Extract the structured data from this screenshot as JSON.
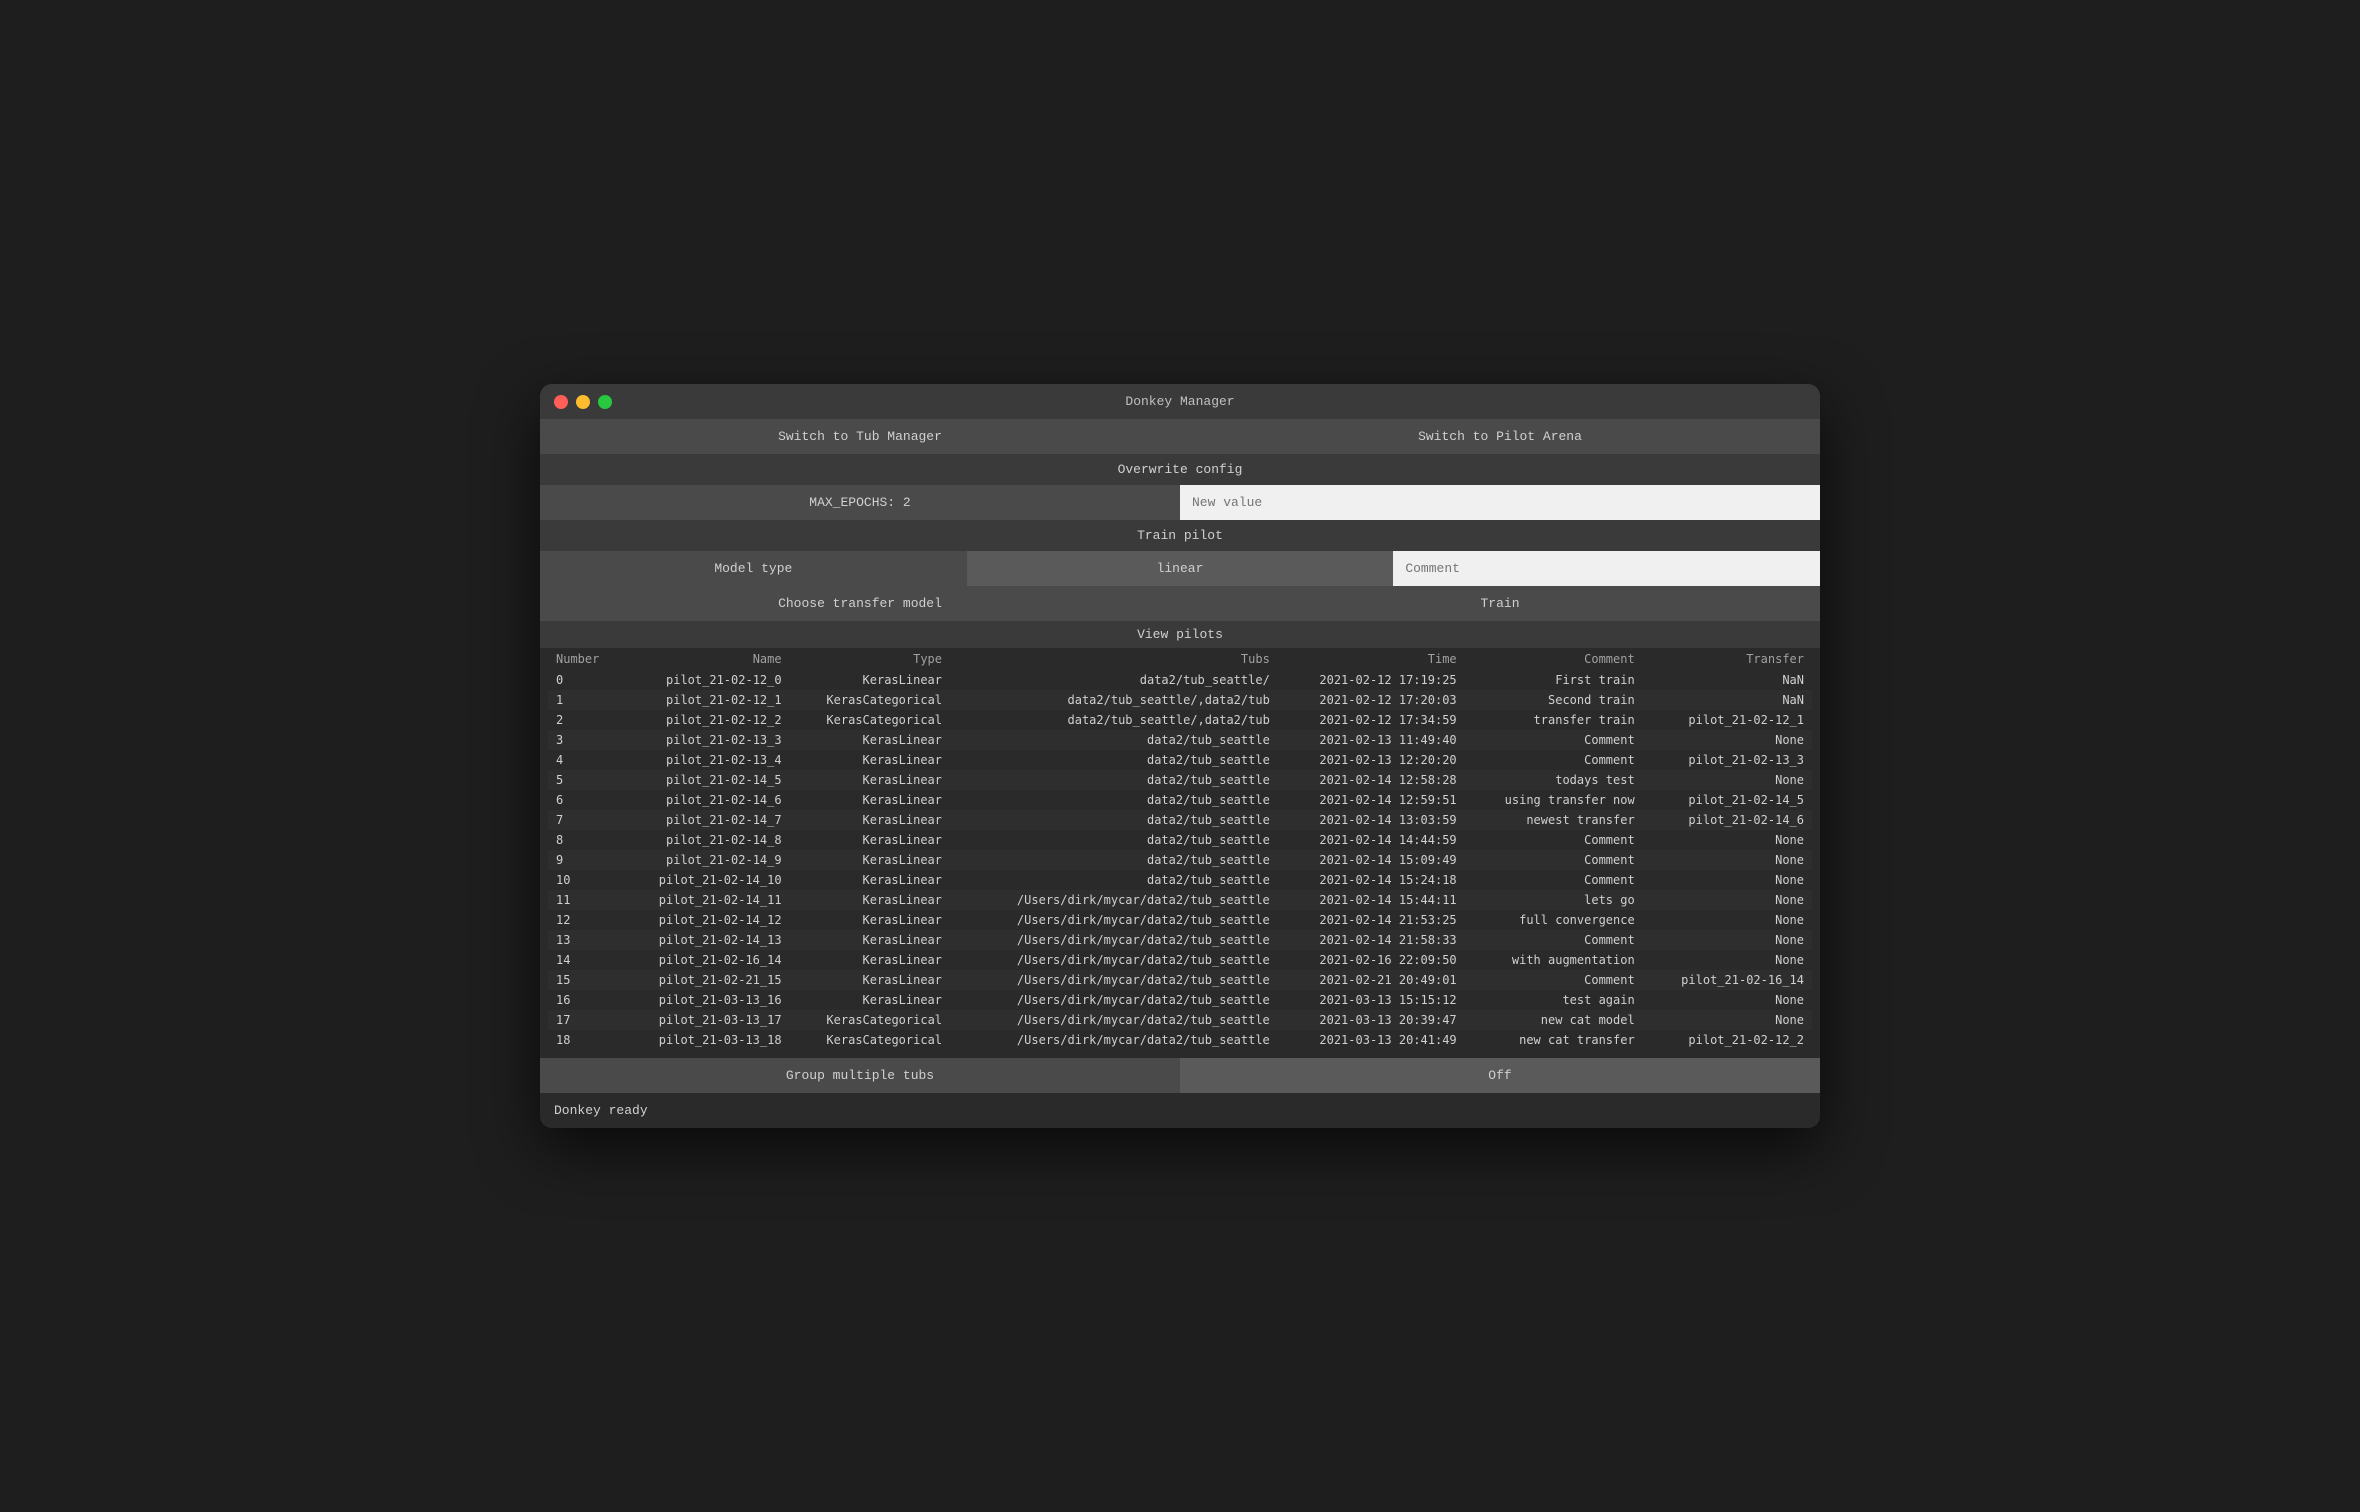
{
  "window": {
    "title": "Donkey Manager"
  },
  "toolbar": {
    "switch_tub_label": "Switch to Tub Manager",
    "switch_pilot_label": "Switch to Pilot Arena"
  },
  "overwrite_config": {
    "header": "Overwrite config",
    "max_epochs_label": "MAX_EPOCHS: 2",
    "new_value_placeholder": "New value"
  },
  "train_pilot": {
    "header": "Train pilot",
    "model_type_label": "Model type",
    "model_type_value": "linear",
    "comment_placeholder": "Comment",
    "choose_transfer_label": "Choose transfer model",
    "train_label": "Train"
  },
  "view_pilots": {
    "header": "View pilots",
    "columns": [
      "Number",
      "Name",
      "Type",
      "Tubs",
      "Time",
      "Comment",
      "Transfer"
    ],
    "rows": [
      {
        "number": "0",
        "name": "pilot_21-02-12_0",
        "type": "KerasLinear",
        "tubs": "data2/tub_seattle/",
        "time": "2021-02-12 17:19:25",
        "comment": "First train",
        "transfer": "NaN"
      },
      {
        "number": "1",
        "name": "pilot_21-02-12_1",
        "type": "KerasCategorical",
        "tubs": "data2/tub_seattle/,data2/tub",
        "time": "2021-02-12 17:20:03",
        "comment": "Second train",
        "transfer": "NaN"
      },
      {
        "number": "2",
        "name": "pilot_21-02-12_2",
        "type": "KerasCategorical",
        "tubs": "data2/tub_seattle/,data2/tub",
        "time": "2021-02-12 17:34:59",
        "comment": "transfer train",
        "transfer": "pilot_21-02-12_1"
      },
      {
        "number": "3",
        "name": "pilot_21-02-13_3",
        "type": "KerasLinear",
        "tubs": "data2/tub_seattle",
        "time": "2021-02-13 11:49:40",
        "comment": "Comment",
        "transfer": "None"
      },
      {
        "number": "4",
        "name": "pilot_21-02-13_4",
        "type": "KerasLinear",
        "tubs": "data2/tub_seattle",
        "time": "2021-02-13 12:20:20",
        "comment": "Comment",
        "transfer": "pilot_21-02-13_3"
      },
      {
        "number": "5",
        "name": "pilot_21-02-14_5",
        "type": "KerasLinear",
        "tubs": "data2/tub_seattle",
        "time": "2021-02-14 12:58:28",
        "comment": "todays test",
        "transfer": "None"
      },
      {
        "number": "6",
        "name": "pilot_21-02-14_6",
        "type": "KerasLinear",
        "tubs": "data2/tub_seattle",
        "time": "2021-02-14 12:59:51",
        "comment": "using transfer now",
        "transfer": "pilot_21-02-14_5"
      },
      {
        "number": "7",
        "name": "pilot_21-02-14_7",
        "type": "KerasLinear",
        "tubs": "data2/tub_seattle",
        "time": "2021-02-14 13:03:59",
        "comment": "newest transfer",
        "transfer": "pilot_21-02-14_6"
      },
      {
        "number": "8",
        "name": "pilot_21-02-14_8",
        "type": "KerasLinear",
        "tubs": "data2/tub_seattle",
        "time": "2021-02-14 14:44:59",
        "comment": "Comment",
        "transfer": "None"
      },
      {
        "number": "9",
        "name": "pilot_21-02-14_9",
        "type": "KerasLinear",
        "tubs": "data2/tub_seattle",
        "time": "2021-02-14 15:09:49",
        "comment": "Comment",
        "transfer": "None"
      },
      {
        "number": "10",
        "name": "pilot_21-02-14_10",
        "type": "KerasLinear",
        "tubs": "data2/tub_seattle",
        "time": "2021-02-14 15:24:18",
        "comment": "Comment",
        "transfer": "None"
      },
      {
        "number": "11",
        "name": "pilot_21-02-14_11",
        "type": "KerasLinear",
        "tubs": "/Users/dirk/mycar/data2/tub_seattle",
        "time": "2021-02-14 15:44:11",
        "comment": "lets go",
        "transfer": "None"
      },
      {
        "number": "12",
        "name": "pilot_21-02-14_12",
        "type": "KerasLinear",
        "tubs": "/Users/dirk/mycar/data2/tub_seattle",
        "time": "2021-02-14 21:53:25",
        "comment": "full convergence",
        "transfer": "None"
      },
      {
        "number": "13",
        "name": "pilot_21-02-14_13",
        "type": "KerasLinear",
        "tubs": "/Users/dirk/mycar/data2/tub_seattle",
        "time": "2021-02-14 21:58:33",
        "comment": "Comment",
        "transfer": "None"
      },
      {
        "number": "14",
        "name": "pilot_21-02-16_14",
        "type": "KerasLinear",
        "tubs": "/Users/dirk/mycar/data2/tub_seattle",
        "time": "2021-02-16 22:09:50",
        "comment": "with augmentation",
        "transfer": "None"
      },
      {
        "number": "15",
        "name": "pilot_21-02-21_15",
        "type": "KerasLinear",
        "tubs": "/Users/dirk/mycar/data2/tub_seattle",
        "time": "2021-02-21 20:49:01",
        "comment": "Comment",
        "transfer": "pilot_21-02-16_14"
      },
      {
        "number": "16",
        "name": "pilot_21-03-13_16",
        "type": "KerasLinear",
        "tubs": "/Users/dirk/mycar/data2/tub_seattle",
        "time": "2021-03-13 15:15:12",
        "comment": "test again",
        "transfer": "None"
      },
      {
        "number": "17",
        "name": "pilot_21-03-13_17",
        "type": "KerasCategorical",
        "tubs": "/Users/dirk/mycar/data2/tub_seattle",
        "time": "2021-03-13 20:39:47",
        "comment": "new cat model",
        "transfer": "None"
      },
      {
        "number": "18",
        "name": "pilot_21-03-13_18",
        "type": "KerasCategorical",
        "tubs": "/Users/dirk/mycar/data2/tub_seattle",
        "time": "2021-03-13 20:41:49",
        "comment": "new cat transfer",
        "transfer": "pilot_21-02-12_2"
      }
    ]
  },
  "bottom": {
    "group_tubs_label": "Group multiple tubs",
    "off_label": "Off"
  },
  "status": {
    "text": "Donkey ready"
  }
}
